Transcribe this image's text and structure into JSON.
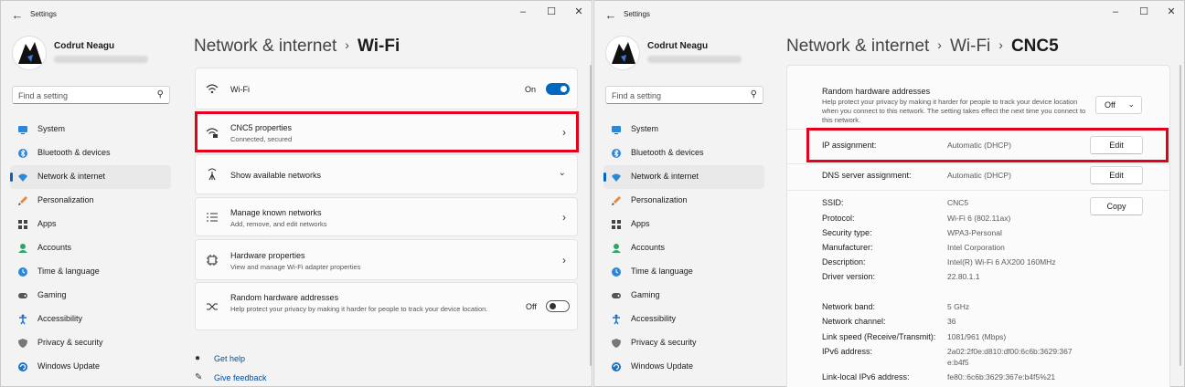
{
  "left_window": {
    "title": "Settings",
    "user_name": "Codrut Neagu",
    "search_placeholder": "Find a setting",
    "breadcrumb": {
      "parent": "Network & internet",
      "current": "Wi-Fi"
    },
    "wifi": {
      "label": "Wi-Fi",
      "state": "On"
    },
    "cnc5": {
      "title": "CNC5 properties",
      "subtitle": "Connected, secured"
    },
    "show_networks": {
      "title": "Show available networks"
    },
    "manage_known": {
      "title": "Manage known networks",
      "subtitle": "Add, remove, and edit networks"
    },
    "hardware": {
      "title": "Hardware properties",
      "subtitle": "View and manage Wi-Fi adapter properties"
    },
    "random_hw": {
      "title": "Random hardware addresses",
      "subtitle": "Help protect your privacy by making it harder for people to track your device location.",
      "state": "Off"
    },
    "get_help": "Get help",
    "give_feedback": "Give feedback"
  },
  "right_window": {
    "title": "Settings",
    "user_name": "Codrut Neagu",
    "search_placeholder": "Find a setting",
    "breadcrumb": {
      "parent": "Network & internet",
      "middle": "Wi-Fi",
      "current": "CNC5"
    },
    "random_hw": {
      "title": "Random hardware addresses",
      "subtitle": "Help protect your privacy by making it harder for people to track your device location when you connect to this network. The setting takes effect the next time you connect to this network.",
      "value": "Off"
    },
    "ip_assignment": {
      "label": "IP assignment:",
      "value": "Automatic (DHCP)",
      "button": "Edit"
    },
    "dns_assignment": {
      "label": "DNS server assignment:",
      "value": "Automatic (DHCP)",
      "button": "Edit"
    },
    "copy_button": "Copy",
    "properties": [
      {
        "label": "SSID:",
        "value": "CNC5"
      },
      {
        "label": "Protocol:",
        "value": "Wi-Fi 6 (802.11ax)"
      },
      {
        "label": "Security type:",
        "value": "WPA3-Personal"
      },
      {
        "label": "Manufacturer:",
        "value": "Intel Corporation"
      },
      {
        "label": "Description:",
        "value": "Intel(R) Wi-Fi 6 AX200 160MHz"
      },
      {
        "label": "Driver version:",
        "value": "22.80.1.1"
      },
      {
        "label": "Network band:",
        "value": "5 GHz"
      },
      {
        "label": "Network channel:",
        "value": "36"
      },
      {
        "label": "Link speed (Receive/Transmit):",
        "value": "1081/961 (Mbps)"
      },
      {
        "label": "IPv6 address:",
        "value": "2a02:2f0e:d810:df00:6c6b:3629:367"
      },
      {
        "label": "",
        "value": "e:b4f5"
      },
      {
        "label": "Link-local IPv6 address:",
        "value": "fe80::6c6b:3629:367e:b4f5%21"
      }
    ]
  },
  "nav_items": [
    {
      "label": "System",
      "icon": "monitor-icon"
    },
    {
      "label": "Bluetooth & devices",
      "icon": "bluetooth-icon"
    },
    {
      "label": "Network & internet",
      "icon": "wifi-icon"
    },
    {
      "label": "Personalization",
      "icon": "brush-icon"
    },
    {
      "label": "Apps",
      "icon": "apps-icon"
    },
    {
      "label": "Accounts",
      "icon": "person-icon"
    },
    {
      "label": "Time & language",
      "icon": "globe-clock-icon"
    },
    {
      "label": "Gaming",
      "icon": "controller-icon"
    },
    {
      "label": "Accessibility",
      "icon": "accessibility-icon"
    },
    {
      "label": "Privacy & security",
      "icon": "shield-icon"
    },
    {
      "label": "Windows Update",
      "icon": "update-icon"
    }
  ],
  "colors": {
    "accent": "#0067c0",
    "highlight_box": "#e4001b",
    "background": "#f3f3f3",
    "card": "#fbfbfb"
  }
}
